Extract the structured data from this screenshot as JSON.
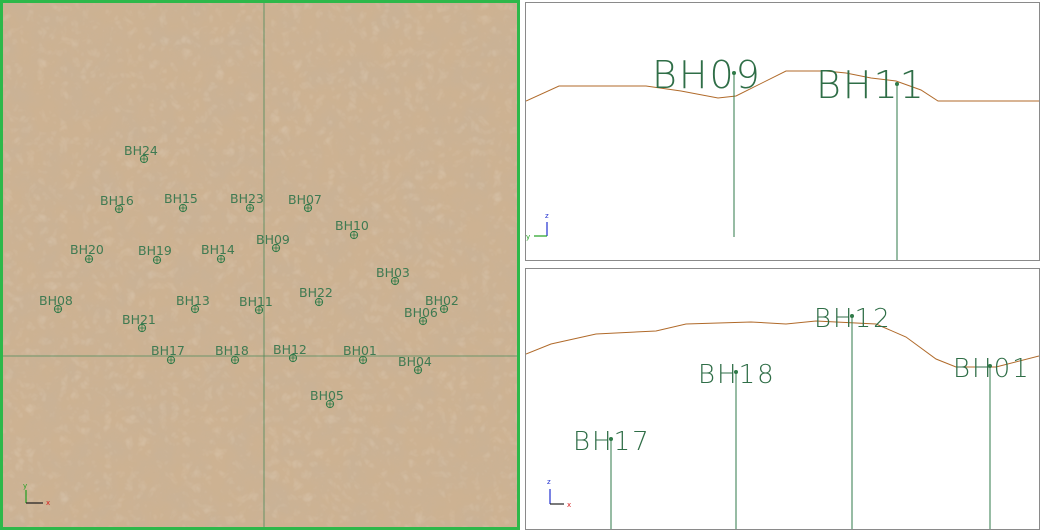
{
  "colors": {
    "terrain": "#c9ad8a",
    "plan_border": "#2db84a",
    "borehole": "#2f7a48",
    "ground_line": "#b06a2a",
    "axis_x": "#d82020",
    "axis_y": "#20a020",
    "axis_z": "#2030d0"
  },
  "plan_view": {
    "axes": {
      "x_label": "x",
      "y_label": "y"
    },
    "boreholes": [
      {
        "id": "BH24"
      },
      {
        "id": "BH16"
      },
      {
        "id": "BH15"
      },
      {
        "id": "BH23"
      },
      {
        "id": "BH07"
      },
      {
        "id": "BH10"
      },
      {
        "id": "BH20"
      },
      {
        "id": "BH19"
      },
      {
        "id": "BH14"
      },
      {
        "id": "BH09"
      },
      {
        "id": "BH03"
      },
      {
        "id": "BH08"
      },
      {
        "id": "BH13"
      },
      {
        "id": "BH11"
      },
      {
        "id": "BH22"
      },
      {
        "id": "BH02"
      },
      {
        "id": "BH06"
      },
      {
        "id": "BH21"
      },
      {
        "id": "BH17"
      },
      {
        "id": "BH18"
      },
      {
        "id": "BH12"
      },
      {
        "id": "BH01"
      },
      {
        "id": "BH04"
      },
      {
        "id": "BH05"
      }
    ]
  },
  "section_1": {
    "axes": {
      "z_label": "z",
      "y_label": "y"
    },
    "boreholes": [
      {
        "id": "BH09"
      },
      {
        "id": "BH11"
      }
    ]
  },
  "section_2": {
    "axes": {
      "z_label": "z",
      "x_label": "x"
    },
    "boreholes": [
      {
        "id": "BH17"
      },
      {
        "id": "BH18"
      },
      {
        "id": "BH12"
      },
      {
        "id": "BH01"
      }
    ]
  }
}
